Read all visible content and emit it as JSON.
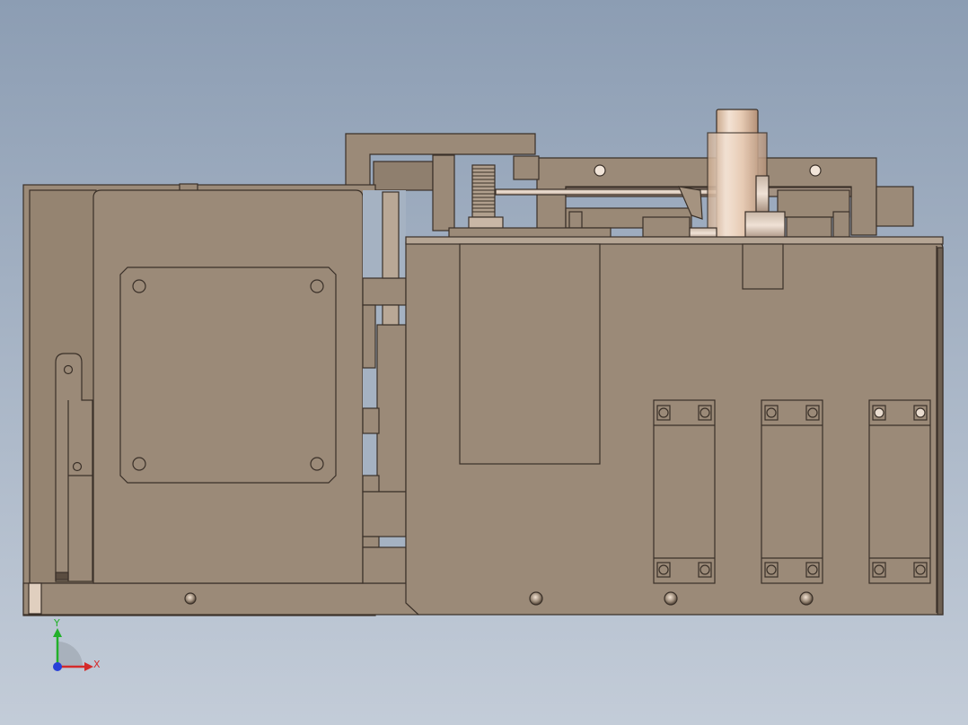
{
  "view": {
    "background_top": "#8c9db3",
    "background_bottom": "#c3ccd8",
    "part_color": "#9b8a78",
    "edge_color": "#3a3028",
    "highlight_color": "#e8d2c0"
  },
  "triad": {
    "x_label": "X",
    "y_label": "Y",
    "x_color": "#d42a2a",
    "y_color": "#22b02a",
    "z_color": "#2840d8"
  }
}
